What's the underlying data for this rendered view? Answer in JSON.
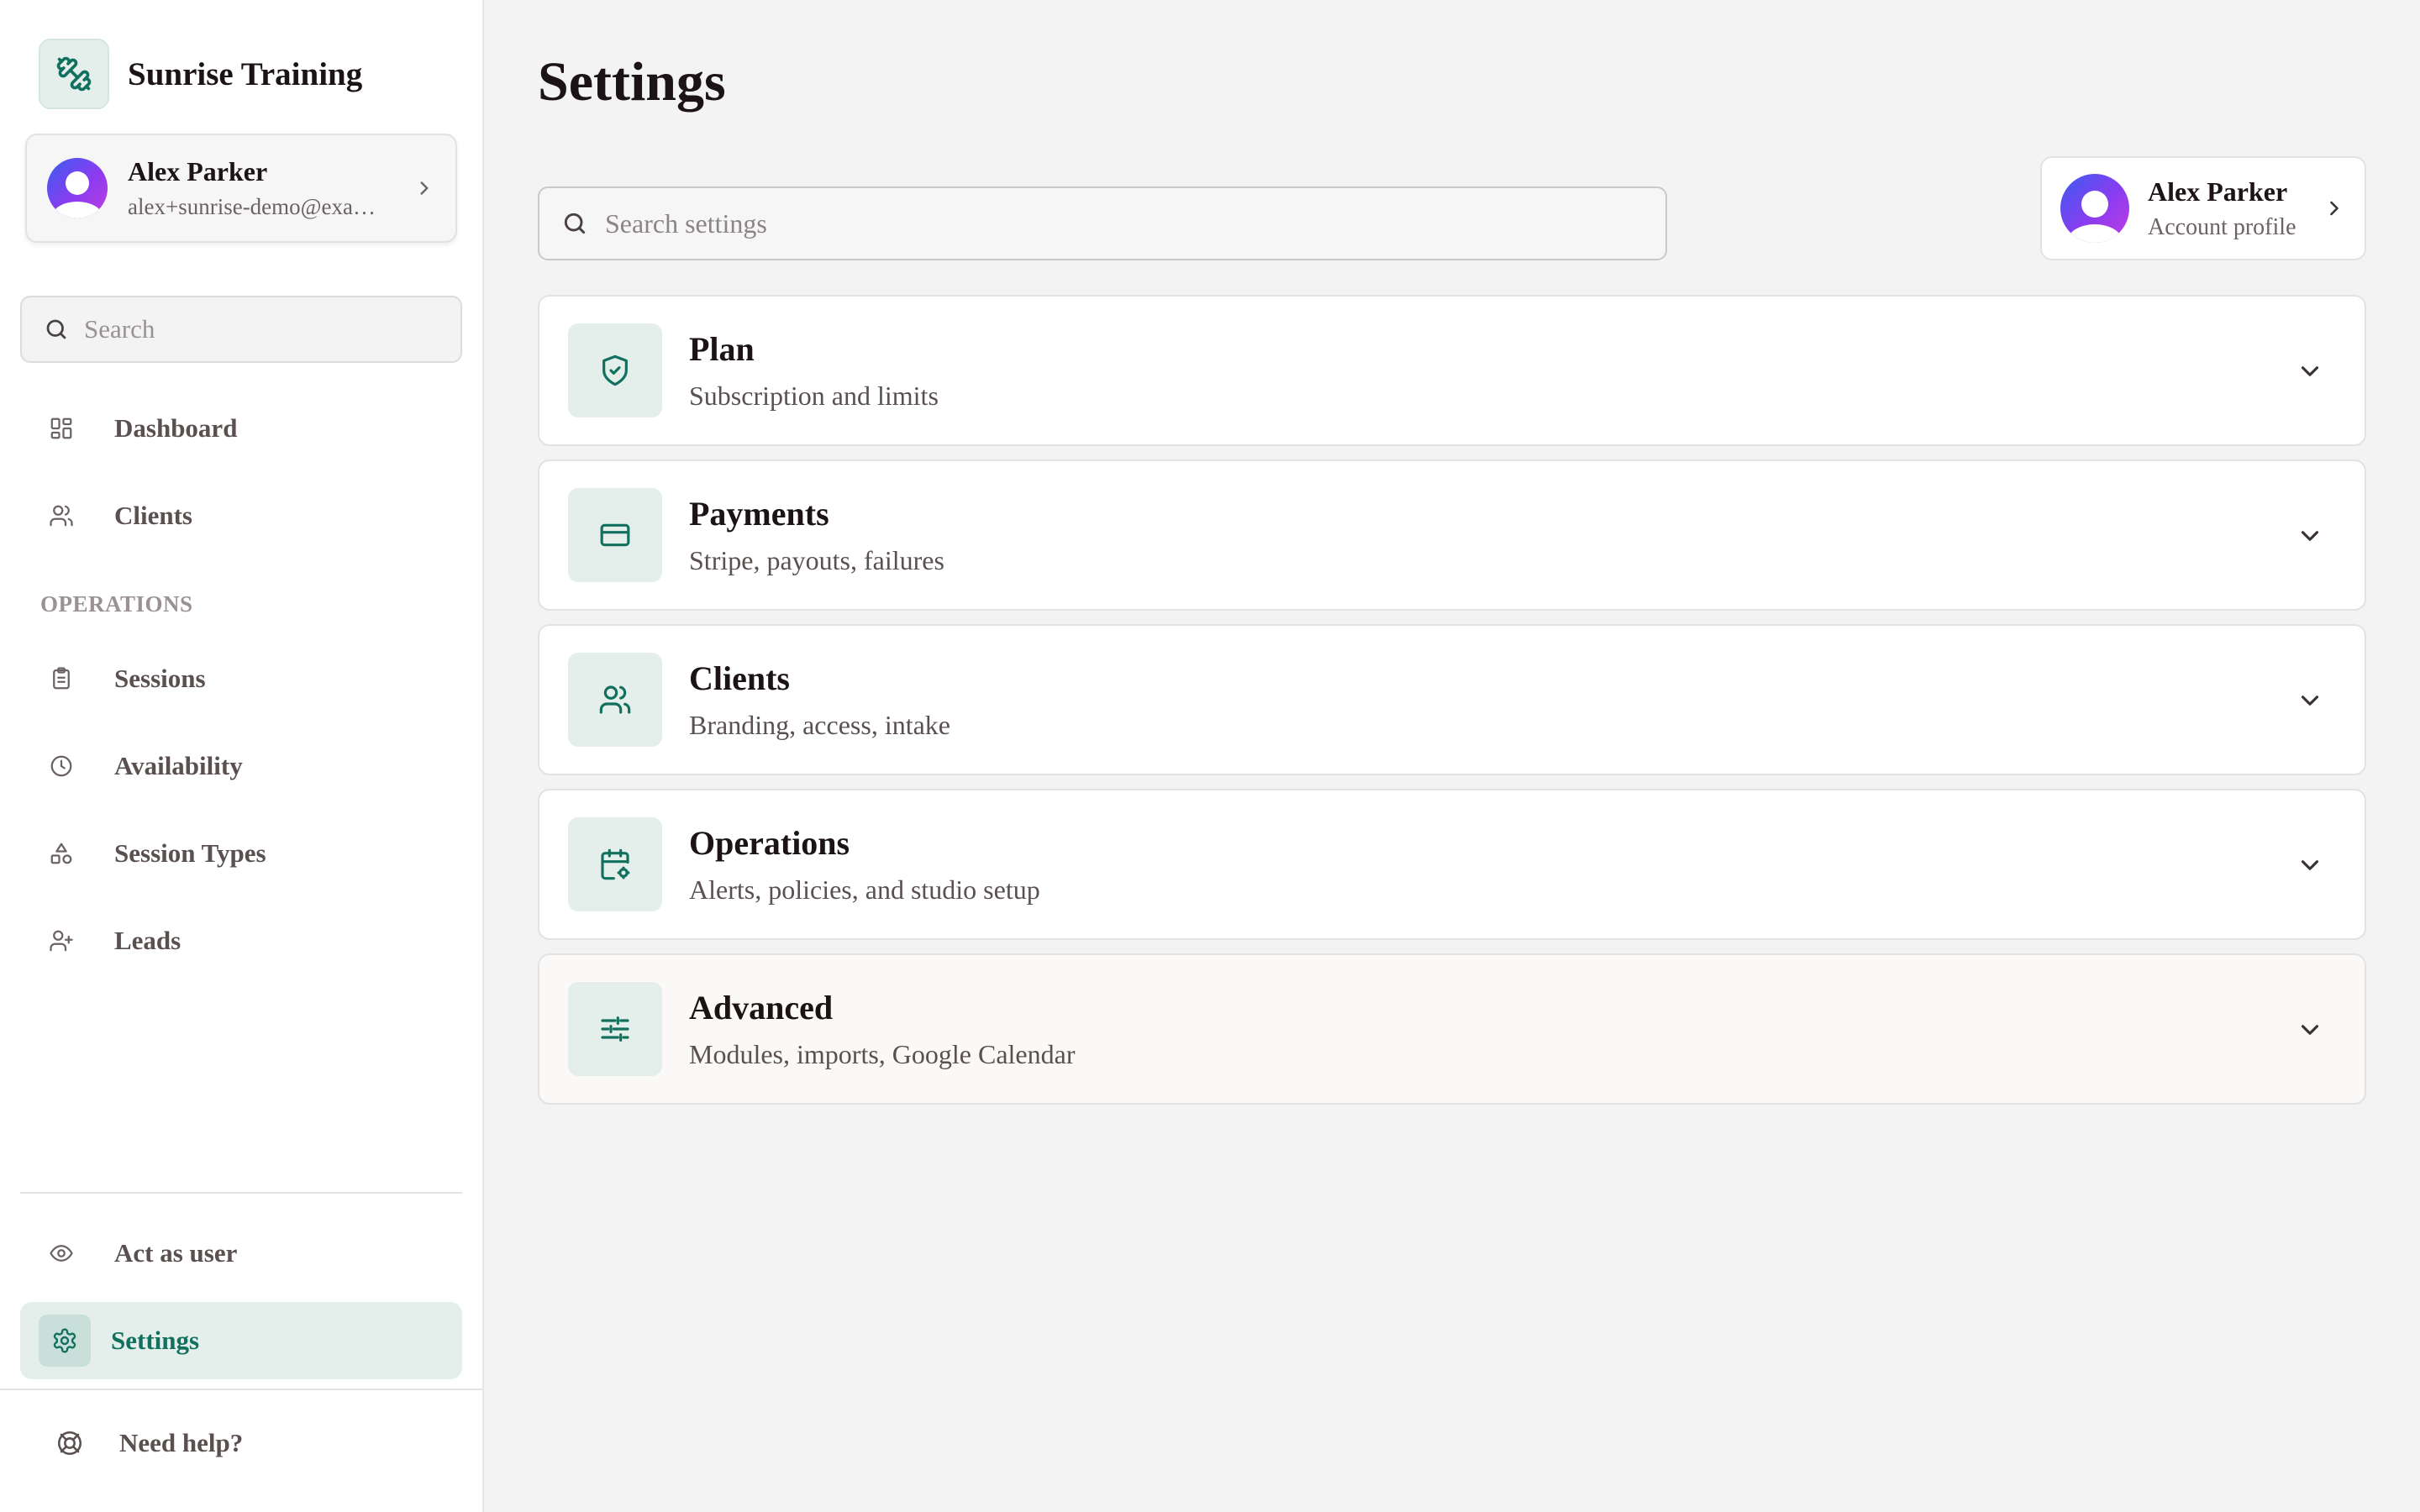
{
  "brand": {
    "name": "Sunrise Training",
    "icon": "dumbbell-icon"
  },
  "user": {
    "name": "Alex Parker",
    "email": "alex+sunrise-demo@exa…"
  },
  "sidebar": {
    "search_placeholder": "Search",
    "nav": [
      {
        "label": "Dashboard",
        "icon": "dashboard-icon"
      },
      {
        "label": "Clients",
        "icon": "users-icon"
      }
    ],
    "section_label": "OPERATIONS",
    "operations": [
      {
        "label": "Sessions",
        "icon": "clipboard-icon"
      },
      {
        "label": "Availability",
        "icon": "clock-icon"
      },
      {
        "label": "Session Types",
        "icon": "shapes-icon"
      },
      {
        "label": "Leads",
        "icon": "user-plus-icon"
      }
    ],
    "act_as_user": "Act as user",
    "settings": "Settings",
    "help": "Need help?"
  },
  "main": {
    "title": "Settings",
    "search_placeholder": "Search settings",
    "profile": {
      "name": "Alex Parker",
      "subtitle": "Account profile"
    },
    "sections": [
      {
        "title": "Plan",
        "subtitle": "Subscription and limits",
        "icon": "shield-check-icon"
      },
      {
        "title": "Payments",
        "subtitle": "Stripe, payouts, failures",
        "icon": "credit-card-icon"
      },
      {
        "title": "Clients",
        "subtitle": "Branding, access, intake",
        "icon": "users-icon"
      },
      {
        "title": "Operations",
        "subtitle": "Alerts, policies, and studio setup",
        "icon": "calendar-settings-icon"
      },
      {
        "title": "Advanced",
        "subtitle": "Modules, imports, Google Calendar",
        "icon": "sliders-icon"
      }
    ]
  },
  "colors": {
    "accent": "#12705e",
    "accent_bg": "#e4efec",
    "page_bg": "#f3f3f3"
  }
}
